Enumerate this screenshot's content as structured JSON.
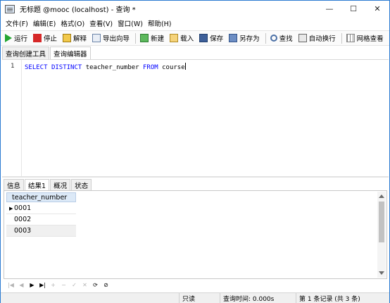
{
  "window": {
    "title": "无标题 @mooc (localhost) - 查询 *",
    "controls": {
      "minimize": "—",
      "maximize": "☐",
      "close": "✕"
    }
  },
  "menu": [
    "文件(F)",
    "编辑(E)",
    "格式(O)",
    "查看(V)",
    "窗口(W)",
    "帮助(H)"
  ],
  "toolbar": {
    "run": "运行",
    "stop": "停止",
    "explain": "解释",
    "export_wizard": "导出向导",
    "new": "新建",
    "load": "载入",
    "save": "保存",
    "save_as": "另存为",
    "find": "查找",
    "word_wrap": "自动换行",
    "grid_view": "网格查看"
  },
  "editor_tabs": {
    "builder": "查询创建工具",
    "editor": "查询编辑器"
  },
  "editor": {
    "line_number": "1",
    "tokens": {
      "kw1": "SELECT",
      "kw2": "DISTINCT",
      "col": "teacher_number",
      "kw3": "FROM",
      "table": "course"
    }
  },
  "result_tabs": {
    "info": "信息",
    "result1": "结果1",
    "overview": "概况",
    "status": "状态"
  },
  "grid": {
    "column": "teacher_number",
    "rows": [
      "0001",
      "0002",
      "0003"
    ]
  },
  "nav": [
    "|◀",
    "◀",
    "▶",
    "▶|",
    "+",
    "−",
    "✓",
    "✕",
    "⟳",
    "⊘"
  ],
  "status": {
    "readonly": "只读",
    "query_time": "查询时间: 0.000s",
    "record": "第 1 条记录 (共 3 条)"
  }
}
